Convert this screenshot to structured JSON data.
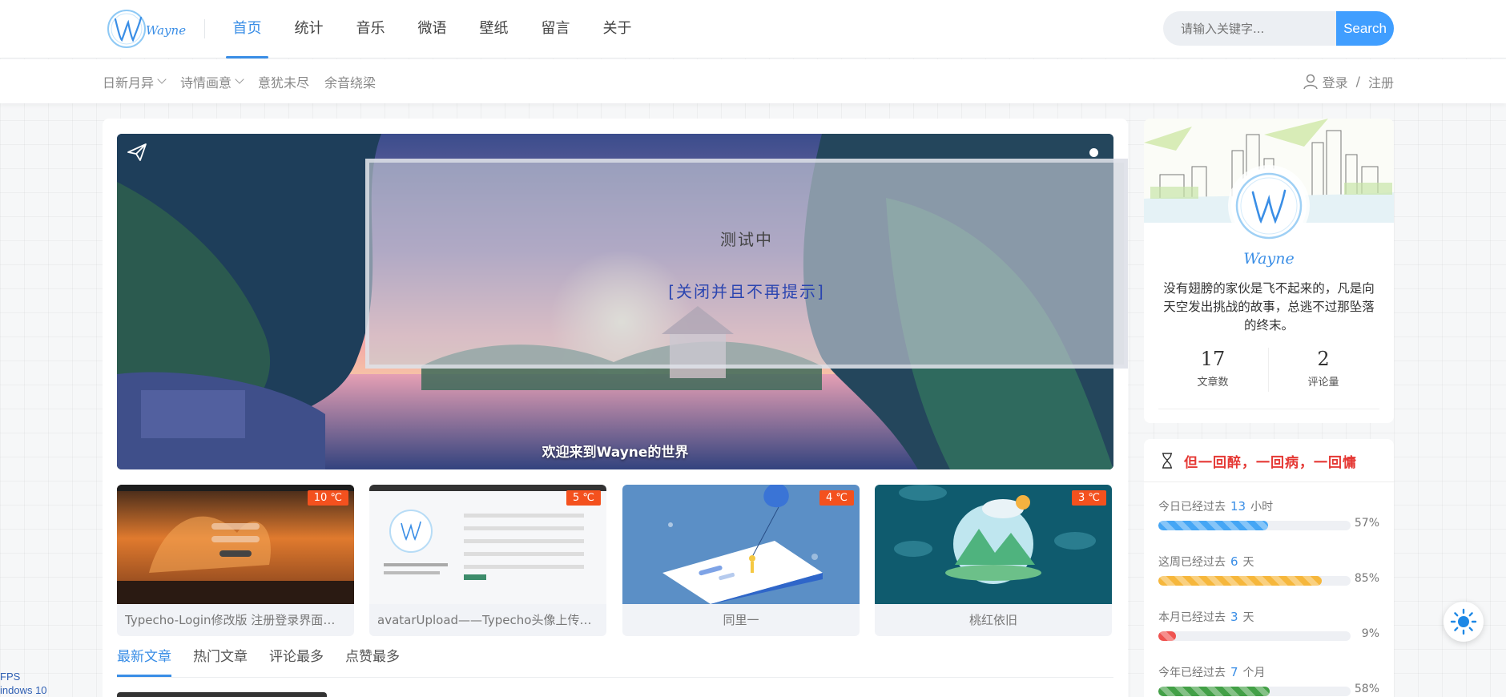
{
  "header": {
    "logo_text": "Wayne",
    "nav": [
      {
        "label": "首页",
        "active": true
      },
      {
        "label": "统计",
        "active": false
      },
      {
        "label": "音乐",
        "active": false
      },
      {
        "label": "微语",
        "active": false
      },
      {
        "label": "壁纸",
        "active": false
      },
      {
        "label": "留言",
        "active": false
      },
      {
        "label": "关于",
        "active": false
      }
    ],
    "search_placeholder": "请输入关键字...",
    "search_button": "Search"
  },
  "subnav": {
    "items": [
      {
        "label": "日新月异",
        "has_dropdown": true
      },
      {
        "label": "诗情画意",
        "has_dropdown": true
      },
      {
        "label": "意犹未尽",
        "has_dropdown": false
      },
      {
        "label": "余音绕梁",
        "has_dropdown": false
      }
    ],
    "login": "登录",
    "divider": "/",
    "register": "注册"
  },
  "banner": {
    "caption": "欢迎来到Wayne的世界",
    "notice_title": "测试中",
    "notice_link": "[关闭并且不再提示]"
  },
  "featured": [
    {
      "title": "Typecho-Login修改版 注册登录界面美化",
      "temp": "10 ℃"
    },
    {
      "title": "avatarUpload——Typecho头像上传插件",
      "temp": "5 ℃"
    },
    {
      "title": "同里一",
      "temp": "4 ℃"
    },
    {
      "title": "桃红依旧",
      "temp": "3 ℃"
    }
  ],
  "tabs": [
    {
      "label": "最新文章",
      "active": true
    },
    {
      "label": "热门文章",
      "active": false
    },
    {
      "label": "评论最多",
      "active": false
    },
    {
      "label": "点赞最多",
      "active": false
    }
  ],
  "profile": {
    "name": "Wayne",
    "bio": "没有翅膀的家伙是飞不起来的，凡是向天空发出挑战的故事，总逃不过那坠落的终末。",
    "posts_count": "17",
    "posts_label": "文章数",
    "comments_count": "2",
    "comments_label": "评论量"
  },
  "time_card": {
    "title": "但一回醉，一回病，一回慵",
    "rows": [
      {
        "prefix": "今日已经过去",
        "value": "13",
        "unit": "小时",
        "percent": "57%",
        "fraction": 0.57,
        "color": "#45a6f5"
      },
      {
        "prefix": "这周已经过去",
        "value": "6",
        "unit": "天",
        "percent": "85%",
        "fraction": 0.85,
        "color": "#f6b73c"
      },
      {
        "prefix": "本月已经过去",
        "value": "3",
        "unit": "天",
        "percent": "9%",
        "fraction": 0.09,
        "color": "#ef5350"
      },
      {
        "prefix": "今年已经过去",
        "value": "7",
        "unit": "个月",
        "percent": "58%",
        "fraction": 0.58,
        "color": "#43a047"
      }
    ]
  },
  "fps": {
    "line1": "FPS",
    "line2": "indows 10"
  }
}
